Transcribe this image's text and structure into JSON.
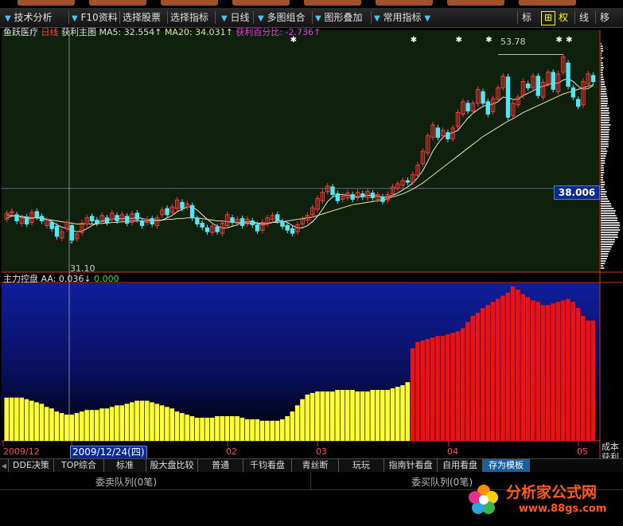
{
  "menu_tabs": [
    "",
    "",
    "",
    "",
    "",
    "",
    "",
    ""
  ],
  "toolbar": {
    "items": [
      {
        "label": "技术分析",
        "arrow": true
      },
      {
        "label": "F10资料",
        "arrow": true
      },
      {
        "label": "选择股票"
      },
      {
        "label": "选择指标"
      },
      {
        "label": "日线",
        "arrow": true
      },
      {
        "label": "多图组合",
        "arrow": true
      },
      {
        "label": "图形叠加",
        "arrow": true
      },
      {
        "label": "常用指标",
        "arrow": true
      }
    ],
    "right": [
      "标",
      "⊞",
      "权",
      "线",
      "移"
    ]
  },
  "main_chart": {
    "stock_name": "鱼跃医疗",
    "period": "日线",
    "indicator": "获利主图",
    "ma5_label": "MA5: 32.554↑",
    "ma20_label": "MA20: 34.031↑",
    "profit_label": "获利百分比: -2.736↑",
    "high_label": "53.78",
    "low_label": "31.10",
    "price_tag": "38.006"
  },
  "sub_chart": {
    "indicator": "主力控盘",
    "aa_label": "AA: 0.036↓",
    "zero_label": "0.000"
  },
  "time_axis": {
    "labels": [
      "2009/12",
      "02",
      "03",
      "04",
      "05"
    ],
    "cursor_date": "2009/12/24(四)"
  },
  "bottom_tabs": [
    "DDE决策",
    "TOP综合",
    "标准",
    "股大盘比较",
    "普通",
    "千钧看盘",
    "青丝断",
    "玩玩",
    "指南针看盘",
    "自用看盘",
    "存为模板"
  ],
  "active_tab": "存为模板",
  "queues": {
    "sell": "委卖队列(0笔)",
    "buy": "委买队列(0笔)"
  },
  "side_labels": [
    "成本",
    "获利",
    "获利"
  ],
  "watermark": {
    "name": "分析家公式网",
    "url": "www.88gs.com"
  },
  "colors": {
    "up": "#ff3a3a",
    "down": "#54e6f2",
    "bar_yellow": "#ffff33",
    "bar_red": "#ee1111",
    "ma5": "#e8e8e8",
    "ma20": "#e6e6a0"
  },
  "chart_data": {
    "type": "candlestick",
    "y_range": [
      28,
      57
    ],
    "candles": [
      [
        34,
        34.8
      ],
      [
        34.8,
        35
      ],
      [
        34.6,
        33.8
      ],
      [
        33.5,
        34.2
      ],
      [
        34.3,
        33.4
      ],
      [
        33.6,
        34.9
      ],
      [
        35,
        34.3
      ],
      [
        34.4,
        33.8
      ],
      [
        33.2,
        33.9
      ],
      [
        33.6,
        32.8
      ],
      [
        33.1,
        31.8
      ],
      [
        31.6,
        32.4
      ],
      [
        32.8,
        33.6
      ],
      [
        33.2,
        31.3
      ],
      [
        31.5,
        32.1
      ],
      [
        32.3,
        33.5
      ],
      [
        33.4,
        34.2
      ],
      [
        34.4,
        33.8
      ],
      [
        33.9,
        33.5
      ],
      [
        33.7,
        34.5
      ],
      [
        34.2,
        33.6
      ],
      [
        34,
        34.8
      ],
      [
        34.5,
        33.8
      ],
      [
        33.9,
        34.6
      ],
      [
        34.4,
        33.5
      ],
      [
        33.6,
        34.7
      ],
      [
        34.8,
        34
      ],
      [
        33.8,
        33.2
      ],
      [
        33.6,
        34
      ],
      [
        34.1,
        33.4
      ],
      [
        33.2,
        34.2
      ],
      [
        34.6,
        35.2
      ],
      [
        35.4,
        34.6
      ],
      [
        34.9,
        35.6
      ],
      [
        35.4,
        36.5
      ],
      [
        36.2,
        35.4
      ],
      [
        35.6,
        36
      ],
      [
        35.8,
        34.2
      ],
      [
        34.1,
        33.4
      ],
      [
        33.5,
        33
      ],
      [
        32.9,
        32.4
      ],
      [
        32.3,
        33.1
      ],
      [
        33,
        32.4
      ],
      [
        32.2,
        33.5
      ],
      [
        33.2,
        34.6
      ],
      [
        34.2,
        33.6
      ],
      [
        33.5,
        34
      ],
      [
        34.1,
        33.2
      ],
      [
        33.4,
        34
      ],
      [
        33.8,
        33.3
      ],
      [
        33.3,
        32.5
      ],
      [
        32.6,
        33.6
      ],
      [
        33.4,
        34.2
      ],
      [
        34,
        34.5
      ],
      [
        34.6,
        33.8
      ],
      [
        33.7,
        33.1
      ],
      [
        33.2,
        32.6
      ],
      [
        32.8,
        32.2
      ],
      [
        32.4,
        33.3
      ],
      [
        33.4,
        34
      ],
      [
        33.9,
        34.5
      ],
      [
        34.6,
        35.5
      ],
      [
        35.3,
        36.7
      ],
      [
        36.4,
        37.5
      ],
      [
        37.6,
        38.3
      ],
      [
        38.2,
        37.2
      ],
      [
        37.3,
        36.4
      ],
      [
        36.6,
        37
      ],
      [
        36.8,
        37.4
      ],
      [
        37.2,
        36.6
      ],
      [
        36.8,
        37.5
      ],
      [
        37.3,
        36.9
      ],
      [
        36.8,
        37.6
      ],
      [
        37.4,
        36.8
      ],
      [
        36.6,
        37.2
      ],
      [
        36.9,
        36.3
      ],
      [
        36.5,
        37.2
      ],
      [
        37.3,
        38.2
      ],
      [
        38,
        38.6
      ],
      [
        38.4,
        39
      ],
      [
        39,
        38.8
      ],
      [
        38.8,
        39.8
      ],
      [
        39.7,
        41
      ],
      [
        41.2,
        42.8
      ],
      [
        42.6,
        44.8
      ],
      [
        44.6,
        46.2
      ],
      [
        45.8,
        44.6
      ],
      [
        44.8,
        45.5
      ],
      [
        45.2,
        44.4
      ],
      [
        44.4,
        45.8
      ],
      [
        46,
        47.8
      ],
      [
        47.6,
        49.2
      ],
      [
        49,
        48
      ],
      [
        48,
        49
      ],
      [
        49,
        50.8
      ],
      [
        50.5,
        49
      ],
      [
        49.2,
        47.6
      ],
      [
        47.9,
        49.6
      ],
      [
        49.5,
        51
      ],
      [
        51,
        52.5
      ],
      [
        52.4,
        47.2
      ],
      [
        47.4,
        49
      ],
      [
        48.8,
        49.8
      ],
      [
        50,
        51.8
      ],
      [
        51.5,
        51
      ],
      [
        51,
        52.5
      ],
      [
        52.5,
        50
      ],
      [
        49.8,
        51.7
      ],
      [
        51.5,
        53
      ],
      [
        53,
        50.8
      ],
      [
        50.5,
        52.8
      ],
      [
        53,
        55
      ],
      [
        54.2,
        51.2
      ],
      [
        51,
        49.8
      ],
      [
        49.5,
        48.6
      ],
      [
        48.8,
        51.8
      ],
      [
        51.5,
        52.8
      ],
      [
        52.6,
        51.8
      ]
    ],
    "ma5": [
      34.2,
      34.4,
      34.5,
      34.3,
      34.1,
      34.1,
      34.3,
      34.2,
      34,
      33.7,
      33.3,
      33,
      32.8,
      32.6,
      32.4,
      32.5,
      32.8,
      33.2,
      33.5,
      33.8,
      33.9,
      34,
      34.1,
      34.1,
      34.2,
      34.1,
      34.3,
      34.1,
      34,
      33.9,
      33.8,
      33.9,
      34.2,
      34.5,
      35,
      35.3,
      35.6,
      35.6,
      35.2,
      34.6,
      34,
      33.5,
      33.1,
      32.9,
      32.9,
      33.1,
      33.3,
      33.6,
      33.7,
      33.7,
      33.5,
      33.3,
      33.4,
      33.6,
      33.8,
      33.8,
      33.6,
      33.2,
      32.9,
      32.9,
      33.2,
      33.7,
      34.4,
      35.3,
      36.3,
      36.9,
      37.2,
      37.2,
      37.1,
      37,
      36.9,
      37,
      37.1,
      37.1,
      37,
      36.9,
      36.9,
      37.1,
      37.4,
      37.8,
      38.2,
      38.7,
      39.4,
      40.3,
      41.5,
      42.8,
      43.8,
      44.6,
      45,
      45.2,
      45.5,
      46.3,
      47.1,
      47.7,
      48.2,
      48.6,
      48.8,
      48.9,
      49.2,
      49.8,
      49.7,
      49.5,
      49.5,
      50,
      50.3,
      50.6,
      51,
      51.2,
      51.4,
      51.6,
      51.6,
      52,
      52.2,
      51.8,
      51.2,
      50.8,
      50.9,
      51.3
    ],
    "ma20": [
      34.6,
      34.5,
      34.4,
      34.4,
      34.3,
      34.2,
      34.2,
      34.1,
      34,
      33.9,
      33.8,
      33.7,
      33.6,
      33.5,
      33.4,
      33.4,
      33.4,
      33.4,
      33.4,
      33.5,
      33.5,
      33.6,
      33.6,
      33.7,
      33.7,
      33.8,
      33.8,
      33.8,
      33.8,
      33.9,
      33.9,
      33.9,
      34,
      34,
      34.1,
      34.1,
      34.2,
      34.2,
      34.2,
      34.1,
      34,
      33.9,
      33.8,
      33.8,
      33.7,
      33.7,
      33.6,
      33.6,
      33.5,
      33.5,
      33.5,
      33.5,
      33.5,
      33.6,
      33.6,
      33.7,
      33.8,
      33.9,
      34,
      34.1,
      34.2,
      34.3,
      34.5,
      34.7,
      34.9,
      35.1,
      35.3,
      35.5,
      35.7,
      35.9,
      36,
      36.1,
      36.2,
      36.3,
      36.4,
      36.5,
      36.7,
      36.9,
      37.1,
      37.3,
      37.6,
      37.9,
      38.3,
      38.7,
      39.2,
      39.7,
      40.2,
      40.7,
      41.2,
      41.7,
      42.2,
      42.7,
      43.2,
      43.7,
      44.2,
      44.7,
      45.1,
      45.5,
      45.9,
      46.3,
      46.7,
      47,
      47.4,
      47.8,
      48.1,
      48.4,
      48.7,
      49,
      49.3,
      49.6,
      49.9,
      50.2,
      50.4,
      50.6,
      50.8,
      51,
      51.2,
      51.4
    ],
    "ref_price": 38.006,
    "sub_range": [
      0,
      1
    ],
    "sub_values": [
      0.28,
      0.28,
      0.28,
      0.28,
      0.27,
      0.26,
      0.25,
      0.24,
      0.22,
      0.21,
      0.19,
      0.18,
      0.17,
      0.17,
      0.18,
      0.19,
      0.2,
      0.2,
      0.2,
      0.21,
      0.21,
      0.22,
      0.23,
      0.23,
      0.24,
      0.25,
      0.26,
      0.26,
      0.26,
      0.25,
      0.24,
      0.23,
      0.22,
      0.21,
      0.19,
      0.18,
      0.17,
      0.16,
      0.15,
      0.15,
      0.15,
      0.15,
      0.16,
      0.16,
      0.16,
      0.16,
      0.16,
      0.15,
      0.14,
      0.14,
      0.14,
      0.13,
      0.13,
      0.13,
      0.13,
      0.14,
      0.16,
      0.19,
      0.23,
      0.27,
      0.3,
      0.31,
      0.32,
      0.32,
      0.32,
      0.32,
      0.33,
      0.33,
      0.33,
      0.33,
      0.32,
      0.32,
      0.32,
      0.33,
      0.33,
      0.33,
      0.33,
      0.34,
      0.35,
      0.36,
      0.38,
      0.6,
      0.64,
      0.65,
      0.66,
      0.67,
      0.68,
      0.68,
      0.69,
      0.7,
      0.71,
      0.73,
      0.77,
      0.81,
      0.83,
      0.86,
      0.88,
      0.9,
      0.92,
      0.94,
      0.96,
      1.0,
      0.98,
      0.95,
      0.93,
      0.91,
      0.9,
      0.88,
      0.88,
      0.89,
      0.9,
      0.91,
      0.92,
      0.9,
      0.86,
      0.81,
      0.78,
      0.78
    ]
  }
}
